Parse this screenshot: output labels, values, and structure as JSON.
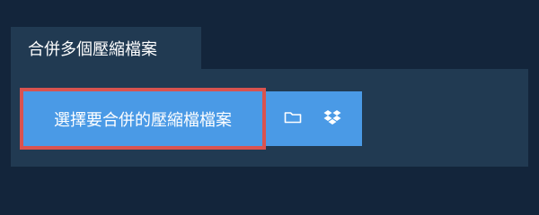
{
  "tab": {
    "label": "合併多個壓縮檔案"
  },
  "upload": {
    "select_label": "選擇要合併的壓縮檔檔案",
    "folder_icon": "folder-icon",
    "dropbox_icon": "dropbox-icon"
  },
  "colors": {
    "page_background": "#13253b",
    "panel_background": "#213a52",
    "button_background": "#4a9ae6",
    "focus_border": "#d9534f",
    "text": "#ffffff"
  }
}
